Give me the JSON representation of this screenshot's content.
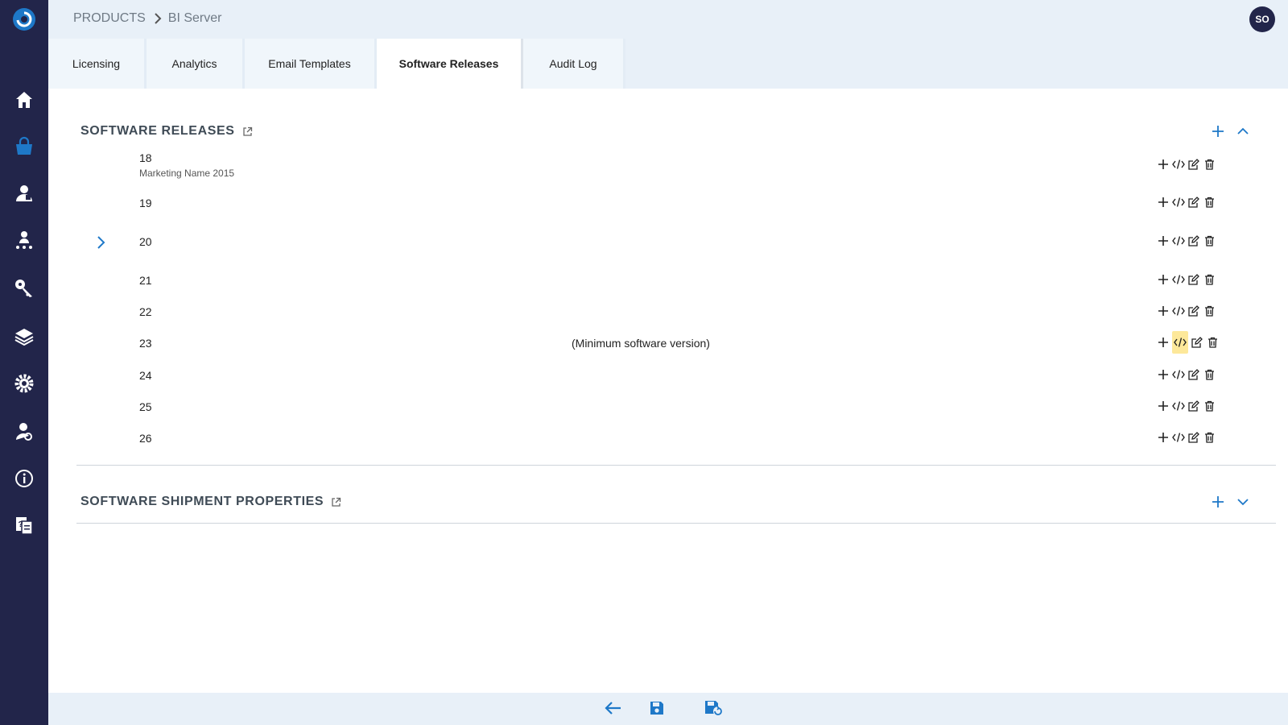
{
  "breadcrumb": {
    "root": "PRODUCTS",
    "current": "BI Server"
  },
  "user": {
    "initials": "SO"
  },
  "tabs": [
    {
      "label": "Licensing"
    },
    {
      "label": "Analytics"
    },
    {
      "label": "Email Templates"
    },
    {
      "label": "Software Releases"
    },
    {
      "label": "Audit Log"
    }
  ],
  "active_tab": "Software Releases",
  "sections": {
    "releases": {
      "title": "SOFTWARE RELEASES"
    },
    "shipment": {
      "title": "SOFTWARE SHIPMENT PROPERTIES"
    }
  },
  "releases": [
    {
      "version": "18",
      "subtitle": "Marketing Name 2015"
    },
    {
      "version": "19"
    },
    {
      "version": "20"
    },
    {
      "version": "21"
    },
    {
      "version": "22"
    },
    {
      "version": "23",
      "note": "(Minimum software version)"
    },
    {
      "version": "24"
    },
    {
      "version": "25"
    },
    {
      "version": "26"
    }
  ],
  "colors": {
    "sidebar_bg": "#22254a",
    "accent_blue": "#1e78c8",
    "topbar_bg": "#e8f0f8",
    "highlight": "#fde89a"
  },
  "icons": {
    "sidebar": [
      "home-icon",
      "shopping-bag-icon",
      "users-icon",
      "org-icon",
      "key-icon",
      "layers-icon",
      "gear-icon",
      "user-settings-icon",
      "info-icon",
      "help-docs-icon"
    ],
    "row_actions": [
      "plus-icon",
      "code-icon",
      "edit-icon",
      "trash-icon"
    ],
    "bottom": [
      "back-arrow-icon",
      "save-icon",
      "save-and-refresh-icon"
    ]
  }
}
